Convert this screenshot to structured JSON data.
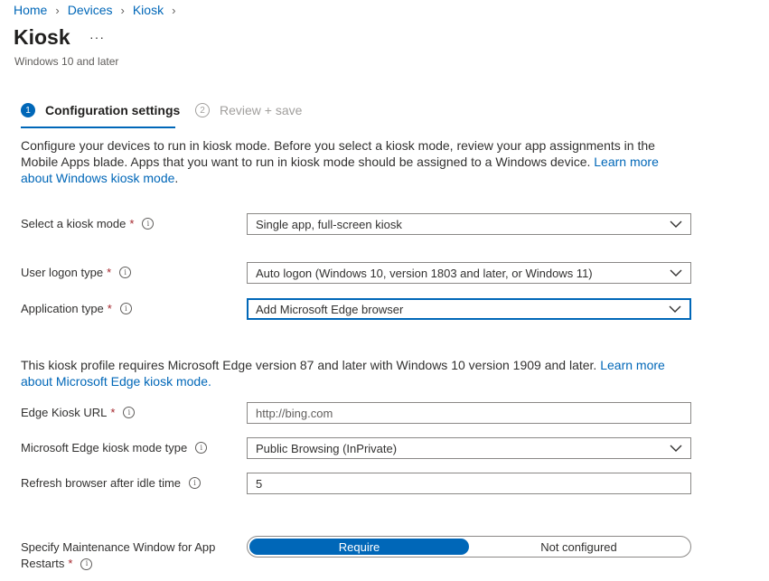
{
  "breadcrumb": [
    {
      "label": "Home"
    },
    {
      "label": "Devices"
    },
    {
      "label": "Kiosk"
    }
  ],
  "page": {
    "title": "Kiosk",
    "more_label": "···",
    "subtitle": "Windows 10 and later"
  },
  "wizard": {
    "steps": [
      {
        "number": "1",
        "label": "Configuration settings",
        "active": true
      },
      {
        "number": "2",
        "label": "Review + save",
        "active": false
      }
    ]
  },
  "intro": {
    "text": "Configure your devices to run in kiosk mode. Before you select a kiosk mode, review your app assignments in the Mobile Apps blade. Apps that you want to run in kiosk mode should be assigned to a Windows device. ",
    "link": "Learn more about Windows kiosk mode",
    "suffix": "."
  },
  "fields": {
    "kiosk_mode": {
      "label": "Select a kiosk mode",
      "required": "*",
      "value": "Single app, full-screen kiosk"
    },
    "user_logon_type": {
      "label": "User logon type",
      "required": "*",
      "value": "Auto logon (Windows 10, version 1803 and later, or Windows 11)"
    },
    "application_type": {
      "label": "Application type",
      "required": "*",
      "value": "Add Microsoft Edge browser"
    },
    "edge_kiosk_url": {
      "label": "Edge Kiosk URL",
      "required": "*",
      "value": "http://bing.com"
    },
    "edge_kiosk_mode_type": {
      "label": "Microsoft Edge kiosk mode type",
      "value": "Public Browsing (InPrivate)"
    },
    "refresh_idle": {
      "label": "Refresh browser after idle time",
      "value": "5"
    },
    "maintenance_window": {
      "label_line1": "Specify Maintenance Window for App",
      "label_line2": "Restarts",
      "required": "*",
      "options": [
        "Require",
        "Not configured"
      ],
      "selected": "Require"
    }
  },
  "edge_note": {
    "text": "This kiosk profile requires Microsoft Edge version 87 and later with Windows 10 version 1909 and later. ",
    "link": "Learn more about Microsoft Edge kiosk mode."
  },
  "icons": {
    "info": "info-icon",
    "chevron": "chevron-down-icon",
    "breadcrumb_separator": "chevron-right-icon"
  },
  "colors": {
    "accent": "#0067b8",
    "required": "#a4262c",
    "border": "#8a8886"
  }
}
